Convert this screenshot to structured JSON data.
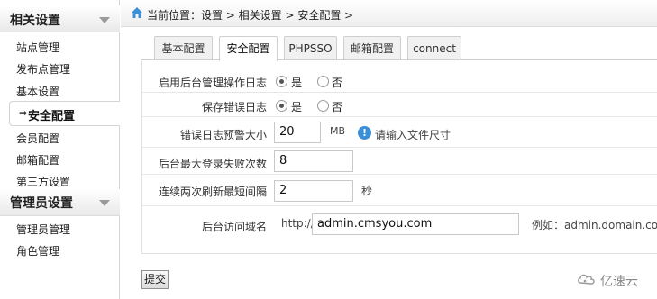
{
  "sidebar": {
    "sections": [
      {
        "title": "相关设置",
        "icon": "collapse-arrow-icon"
      },
      {
        "title": "管理员设置",
        "icon": "collapse-arrow-icon"
      }
    ],
    "items": [
      {
        "label": "站点管理"
      },
      {
        "label": "发布点管理"
      },
      {
        "label": "基本设置"
      },
      {
        "label": "安全配置",
        "active": true
      },
      {
        "label": "会员配置"
      },
      {
        "label": "邮箱配置"
      },
      {
        "label": "第三方设置"
      }
    ],
    "admin_items": [
      {
        "label": "管理员管理"
      },
      {
        "label": "角色管理"
      }
    ],
    "active_marker": "➡"
  },
  "breadcrumb": {
    "icon": "home-icon",
    "text": "当前位置：设置 > 相关设置 > 安全配置 >"
  },
  "tabs": [
    {
      "label": "基本配置"
    },
    {
      "label": "安全配置",
      "active": true
    },
    {
      "label": "PHPSSO"
    },
    {
      "label": "邮箱配置"
    },
    {
      "label": "connect"
    }
  ],
  "form": {
    "admin_log": {
      "label": "启用后台管理操作日志",
      "options": [
        "是",
        "否"
      ],
      "selected": "是"
    },
    "error_log": {
      "label": "保存错误日志",
      "options": [
        "是",
        "否"
      ],
      "selected": "是"
    },
    "errorlog_size": {
      "label": "错误日志预警大小",
      "value": "20",
      "unit": "MB",
      "hint": "请输入文件尺寸",
      "hint_icon": "info-icon"
    },
    "max_login_fail": {
      "label": "后台最大登录失败次数",
      "value": "8"
    },
    "min_refresh": {
      "label": "连续两次刷新最短间隔",
      "value": "2",
      "unit": "秒"
    },
    "admin_domain": {
      "label": "后台访问域名",
      "prefix": "http://",
      "value": "admin.cmsyou.com",
      "example": "例如：admin.domain.com"
    }
  },
  "submit_label": "提交",
  "watermark": {
    "text": "亿速云",
    "icon": "cloud-logo-icon"
  },
  "colors": {
    "accent": "#3b8fd6",
    "border": "#cfcfcf",
    "watermark": "#8a8a8a"
  }
}
